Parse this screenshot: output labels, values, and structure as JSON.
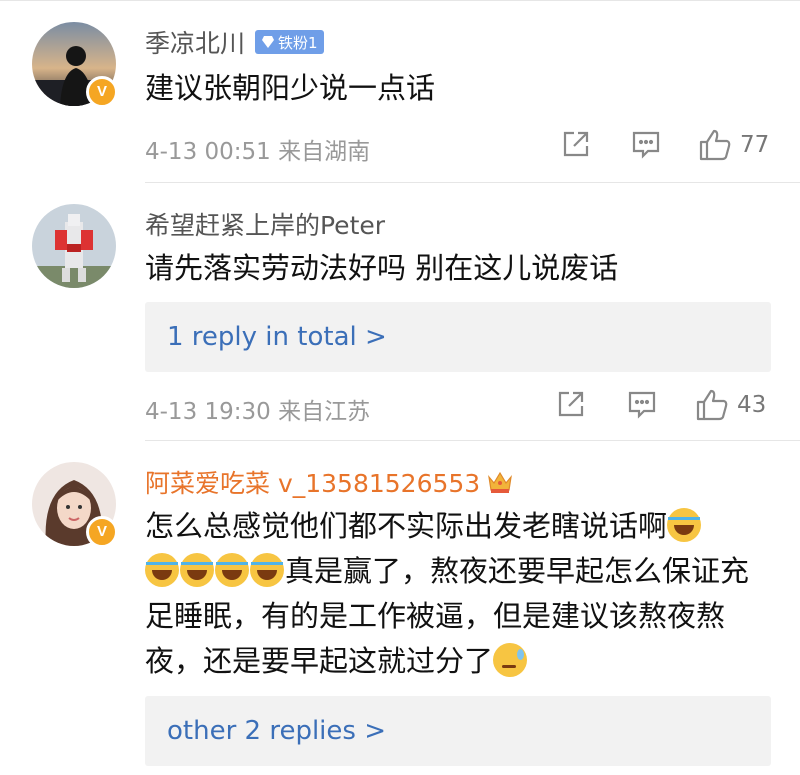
{
  "comments": [
    {
      "username": "季凉北川",
      "fan_badge": "铁粉1",
      "text": "建议张朝阳少说一点话",
      "timestamp": "4-13 00:51 来自湖南",
      "likes": "77",
      "verified": "V"
    },
    {
      "username": "希望赶紧上岸的Peter",
      "text": "请先落实劳动法好吗 别在这儿说废话",
      "replies_link": "1 reply in total >",
      "timestamp": "4-13 19:30 来自江苏",
      "likes": "43"
    },
    {
      "username": "阿菜爱吃菜 v_13581526553",
      "text_part1": "怎么总感觉他们都不实际出发老瞎说话啊",
      "text_part2": "真是赢了，熬夜还要早起怎么保证充足睡眠，有的是工作被逼，但是建议该熬夜熬夜，还是要早起这就过分了",
      "replies_link": "other 2 replies >",
      "verified": "V"
    }
  ],
  "icons": [
    "repost-icon",
    "comment-icon",
    "like-icon",
    "crown-icon",
    "diamond-icon",
    "laugh-cry-emoji",
    "sweat-emoji"
  ],
  "colors": {
    "link": "#3b6fb8",
    "vip_name": "#e8742a",
    "badge": "#6f9ee8",
    "verified": "#f5a623"
  }
}
